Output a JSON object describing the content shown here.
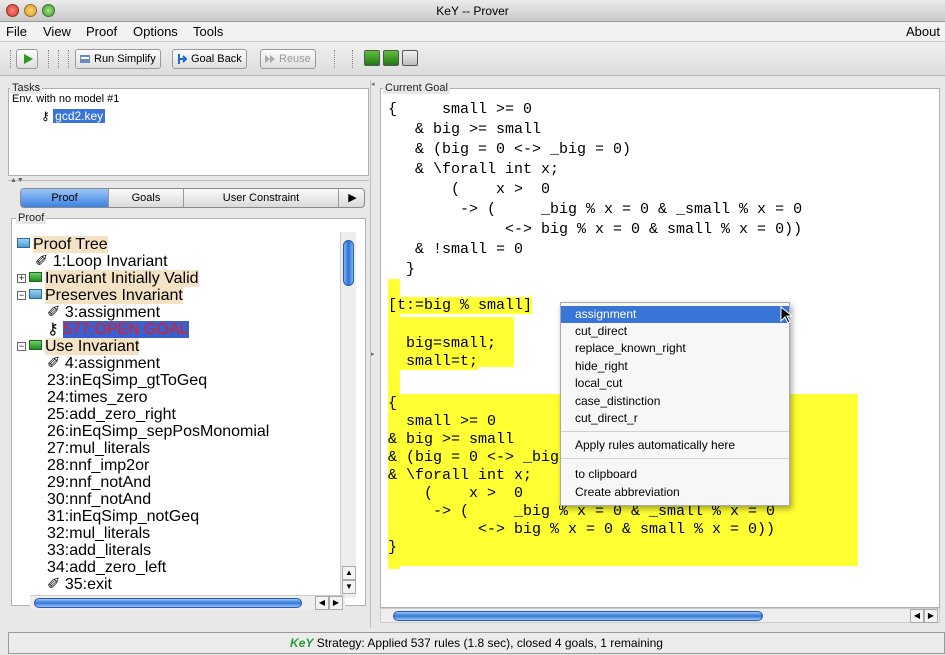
{
  "window": {
    "title": "KeY -- Prover"
  },
  "menu": {
    "items": [
      "File",
      "View",
      "Proof",
      "Options",
      "Tools"
    ],
    "about": "About"
  },
  "toolbar": {
    "run_simplify": "Run Simplify",
    "goal_back": "Goal Back",
    "reuse": "Reuse"
  },
  "tasks": {
    "label": "Tasks",
    "env": "Env. with no model #1",
    "file": "gcd2.key"
  },
  "tabs": {
    "proof": "Proof",
    "goals": "Goals",
    "user_constraint": "User Constraint"
  },
  "proof": {
    "label": "Proof",
    "nodes": [
      "Proof Tree",
      "1:Loop Invariant",
      "Invariant Initially Valid",
      "Preserves Invariant",
      "3:assignment",
      "577:OPEN GOAL",
      "Use Invariant",
      "4:assignment",
      "23:inEqSimp_gtToGeq",
      "24:times_zero",
      "25:add_zero_right",
      "26:inEqSimp_sepPosMonomial",
      "27:mul_literals",
      "28:nnf_imp2or",
      "29:nnf_notAnd",
      "30:nnf_notAnd",
      "31:inEqSimp_notGeq",
      "32:mul_literals",
      "33:add_literals",
      "34:add_zero_left",
      "35:exit"
    ]
  },
  "goal": {
    "label": "Current Goal",
    "lines_top": [
      "{     small >= 0",
      "   & big >= small",
      "   & (big = 0 <-> _big = 0)",
      "   & \\forall int x;",
      "       (    x >  0",
      "        -> (     _big % x = 0 & _small % x = 0",
      "             <-> big % x = 0 & small % x = 0))",
      "   & !small = 0",
      "  }"
    ],
    "update_line": "[t:=big % small]",
    "lines_mid": [
      "  big=small;",
      "  small=t;"
    ],
    "lines_bottom": [
      "{",
      "  small >= 0",
      "& big >= small",
      "& (big = 0 <-> _big = 0)",
      "& \\forall int x;",
      "    (    x >  0",
      "     -> (     _big % x = 0 & _small % x = 0",
      "          <-> big % x = 0 & small % x = 0))",
      "}"
    ]
  },
  "context_menu": {
    "items": [
      "assignment",
      "cut_direct",
      "replace_known_right",
      "hide_right",
      "local_cut",
      "case_distinction",
      "cut_direct_r"
    ],
    "apply_auto": "Apply rules automatically here",
    "to_clipboard": "to clipboard",
    "create_abbrev": "Create abbreviation"
  },
  "status": {
    "logo": "KeY",
    "text": "Strategy: Applied 537 rules (1.8 sec),  closed 4 goals, 1 remaining"
  },
  "colors": {
    "highlight_yellow": "#ffff33",
    "menu_select": "#3875d7",
    "open_goal_bg": "#3a5fd0",
    "open_goal_fg": "#e0201a",
    "node_highlight": "#f3e2c3"
  }
}
